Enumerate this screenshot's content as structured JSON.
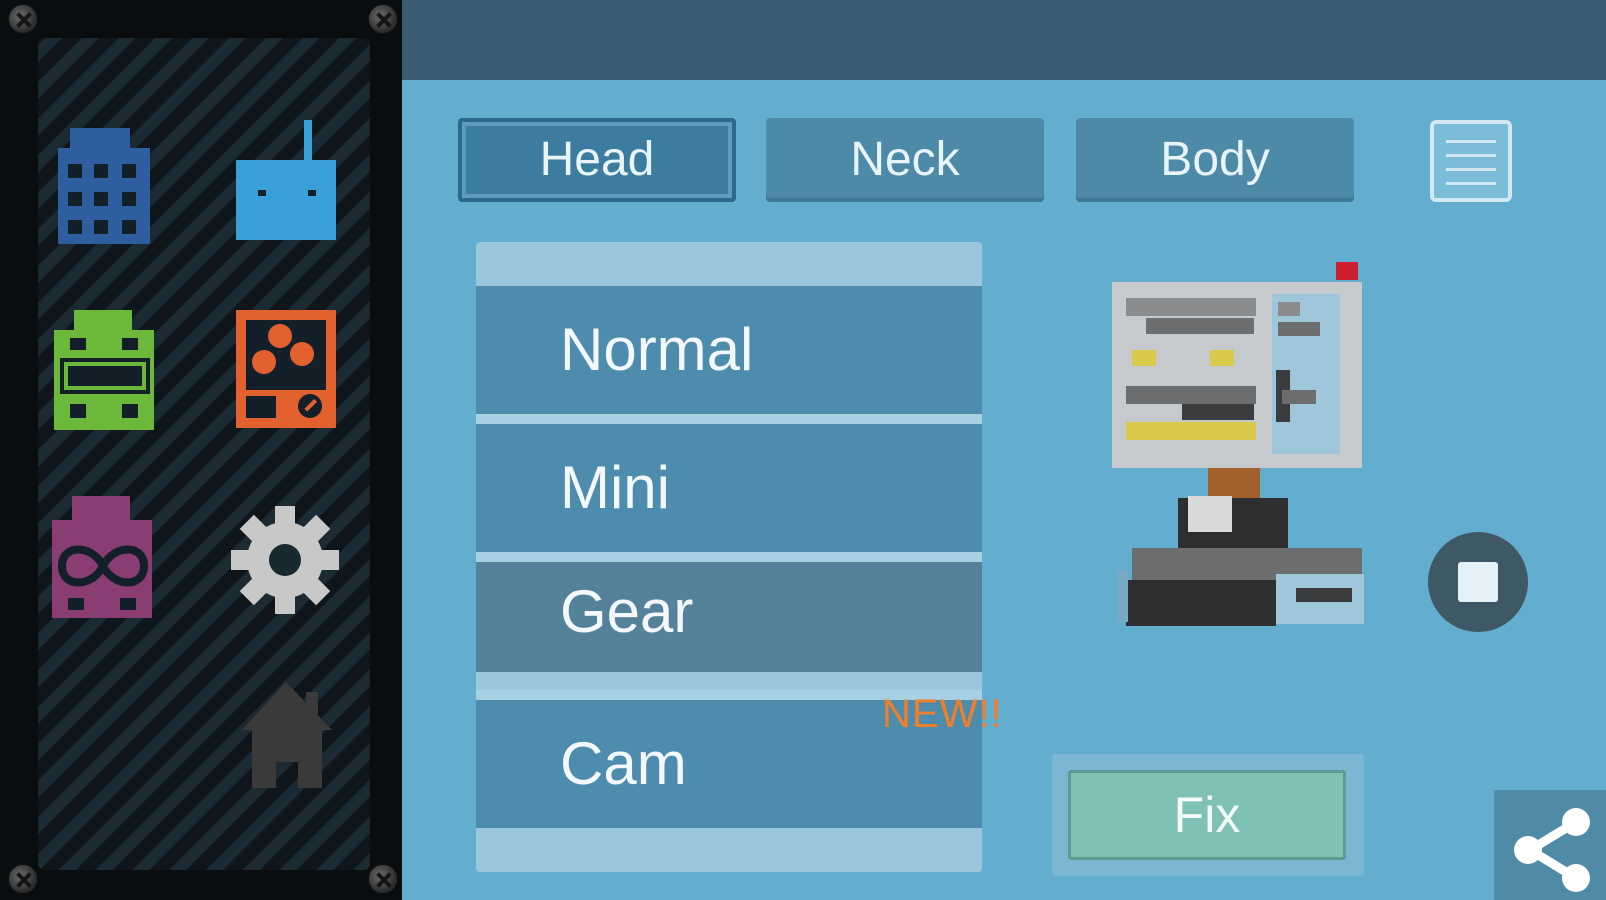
{
  "sidebar": {
    "icons": [
      {
        "name": "building-icon",
        "color": "#2f5ea0"
      },
      {
        "name": "robot-icon",
        "color": "#3aa0d8"
      },
      {
        "name": "green-robot-icon",
        "color": "#6cb83a"
      },
      {
        "name": "orange-robot-icon",
        "color": "#e3602f"
      },
      {
        "name": "infinity-robot-icon",
        "color": "#8a3d72"
      },
      {
        "name": "gear-icon",
        "color": "#c8c8c8"
      },
      {
        "name": "home-icon",
        "color": "#3a3a3a"
      }
    ]
  },
  "tabs": [
    {
      "label": "Head",
      "active": true
    },
    {
      "label": "Neck",
      "active": false
    },
    {
      "label": "Body",
      "active": false
    }
  ],
  "menu_icon": "list-menu-icon",
  "list": {
    "items": [
      {
        "label": "Normal"
      },
      {
        "label": "Mini"
      },
      {
        "label": "Gear",
        "selected": true
      },
      {
        "label": "Cam"
      }
    ],
    "new_badge": "NEW!!"
  },
  "actions": {
    "fix_label": "Fix",
    "stop_icon": "stop-icon",
    "share_icon": "share-icon"
  },
  "colors": {
    "accent": "#63aece",
    "topbar": "#3a5c70",
    "badge": "#ef7f2b",
    "fix": "#7fc2b5"
  }
}
